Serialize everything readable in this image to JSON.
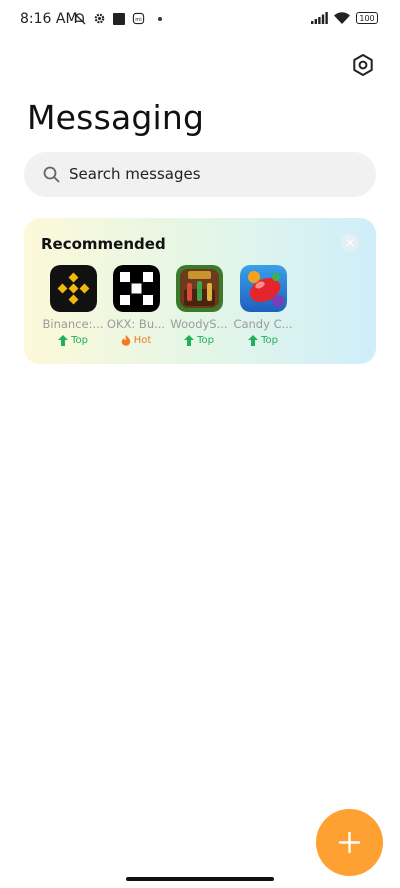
{
  "status_bar": {
    "time": "8:16 AM",
    "battery": "100"
  },
  "header": {
    "title": "Messaging"
  },
  "search": {
    "placeholder": "Search messages"
  },
  "recommended": {
    "title": "Recommended",
    "apps": [
      {
        "name": "Binance:...",
        "tag": "Top",
        "icon": "binance-icon"
      },
      {
        "name": "OKX: Bu...",
        "tag": "Hot",
        "icon": "okx-icon"
      },
      {
        "name": "WoodyS...",
        "tag": "Top",
        "icon": "woody-sort-icon"
      },
      {
        "name": "Candy C...",
        "tag": "Top",
        "icon": "candy-crush-icon"
      }
    ]
  },
  "colors": {
    "fab": "#ffa033",
    "top_tag": "#20b05a",
    "hot_tag": "#f07a1e"
  }
}
